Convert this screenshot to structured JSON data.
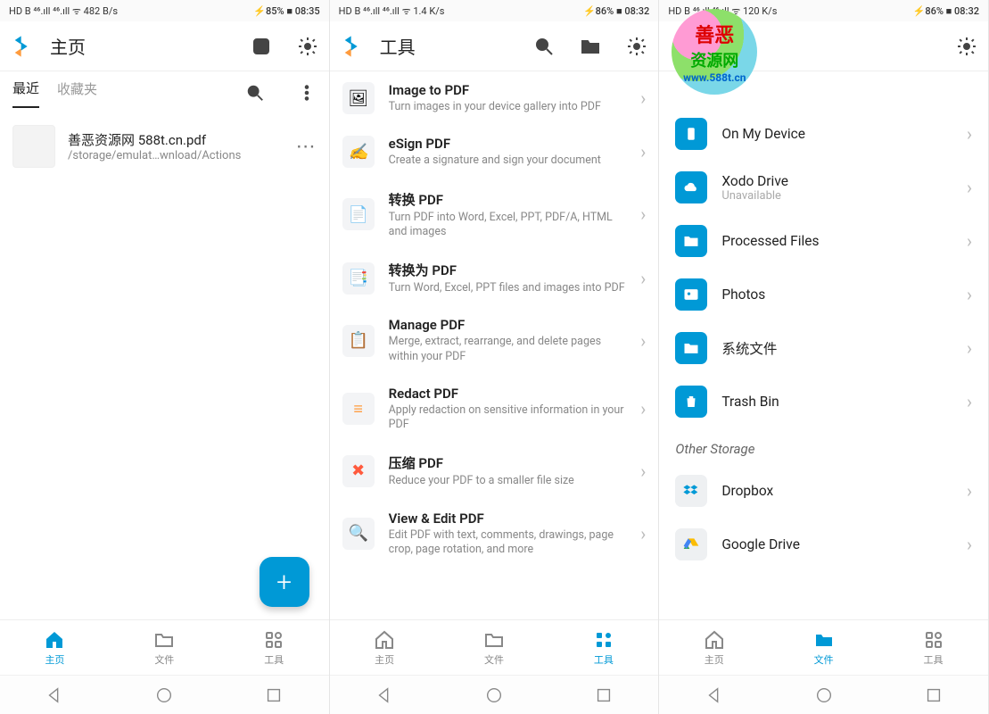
{
  "screen1": {
    "status": {
      "left": "HD B  ⁴⁶.ıll  ⁴⁶.ıll  ᯤ  482 B/s",
      "right": "⚡85% ■ 08:35"
    },
    "header": {
      "title": "主页"
    },
    "tabs": {
      "recent": "最近",
      "fav": "收藏夹"
    },
    "file": {
      "name": "善恶资源网 588t.cn.pdf",
      "path": "/storage/emulat…wnload/Actions"
    },
    "nav": {
      "home": "主页",
      "files": "文件",
      "tools": "工具"
    }
  },
  "screen2": {
    "status": {
      "left": "HD B  ⁴⁶.ıll  ⁴⁶.ıll  ᯤ  1.4 K/s",
      "right": "⚡86% ■ 08:32"
    },
    "header": {
      "title": "工具"
    },
    "tools": [
      {
        "icon": "🖼",
        "title": "Image to PDF",
        "desc": "Turn images in your device gallery into PDF"
      },
      {
        "icon": "✍",
        "title": "eSign PDF",
        "desc": "Create a signature and sign your document"
      },
      {
        "icon": "📄",
        "title": "转换 PDF",
        "desc": "Turn PDF into Word, Excel, PPT, PDF/A, HTML and images"
      },
      {
        "icon": "📑",
        "title": "转换为 PDF",
        "desc": "Turn Word, Excel, PPT files and images into PDF"
      },
      {
        "icon": "📋",
        "title": "Manage PDF",
        "desc": "Merge, extract, rearrange, and delete pages within your PDF"
      },
      {
        "icon": "≡",
        "title": "Redact PDF",
        "desc": "Apply redaction on sensitive information in your PDF"
      },
      {
        "icon": "✖",
        "title": "压缩 PDF",
        "desc": "Reduce your PDF to a smaller file size"
      },
      {
        "icon": "🔍",
        "title": "View & Edit PDF",
        "desc": "Edit PDF with text, comments, drawings, page crop, page rotation, and more"
      }
    ],
    "nav": {
      "home": "主页",
      "files": "文件",
      "tools": "工具"
    }
  },
  "screen3": {
    "status": {
      "left": "HD B  ⁴⁶.ıll  ⁴⁶.ıll  ᯤ  120 K/s",
      "right": "⚡86% ■ 08:32"
    },
    "watermark": {
      "l1": "善恶",
      "l2": "资源网",
      "l3": "www.588t.cn"
    },
    "storage": [
      {
        "title": "On My Device",
        "sub": ""
      },
      {
        "title": "Xodo Drive",
        "sub": "Unavailable"
      },
      {
        "title": "Processed Files",
        "sub": ""
      },
      {
        "title": "Photos",
        "sub": ""
      },
      {
        "title": "系统文件",
        "sub": ""
      },
      {
        "title": "Trash Bin",
        "sub": ""
      }
    ],
    "other_head": "Other Storage",
    "other": [
      {
        "title": "Dropbox"
      },
      {
        "title": "Google Drive"
      }
    ],
    "nav": {
      "home": "主页",
      "files": "文件",
      "tools": "工具"
    }
  }
}
